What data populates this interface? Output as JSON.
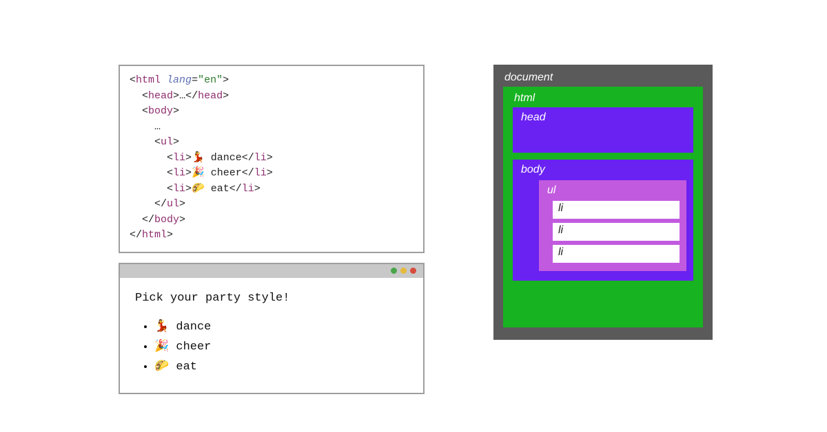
{
  "code": {
    "lang_attr": "lang",
    "lang_value": "\"en\"",
    "tags": {
      "html": "html",
      "head": "head",
      "body": "body",
      "ul": "ul",
      "li": "li"
    },
    "ellipsis": "…",
    "items": [
      {
        "emoji": "💃",
        "text": " dance"
      },
      {
        "emoji": "🎉",
        "text": " cheer"
      },
      {
        "emoji": "🌮",
        "text": " eat"
      }
    ]
  },
  "rendered": {
    "heading": "Pick your party style!",
    "items": [
      {
        "emoji": "💃",
        "text": " dance"
      },
      {
        "emoji": "🎉",
        "text": " cheer"
      },
      {
        "emoji": "🌮",
        "text": " eat"
      }
    ]
  },
  "tree": {
    "document": "document",
    "html": "html",
    "head": "head",
    "body": "body",
    "ul": "ul",
    "li": "li"
  }
}
